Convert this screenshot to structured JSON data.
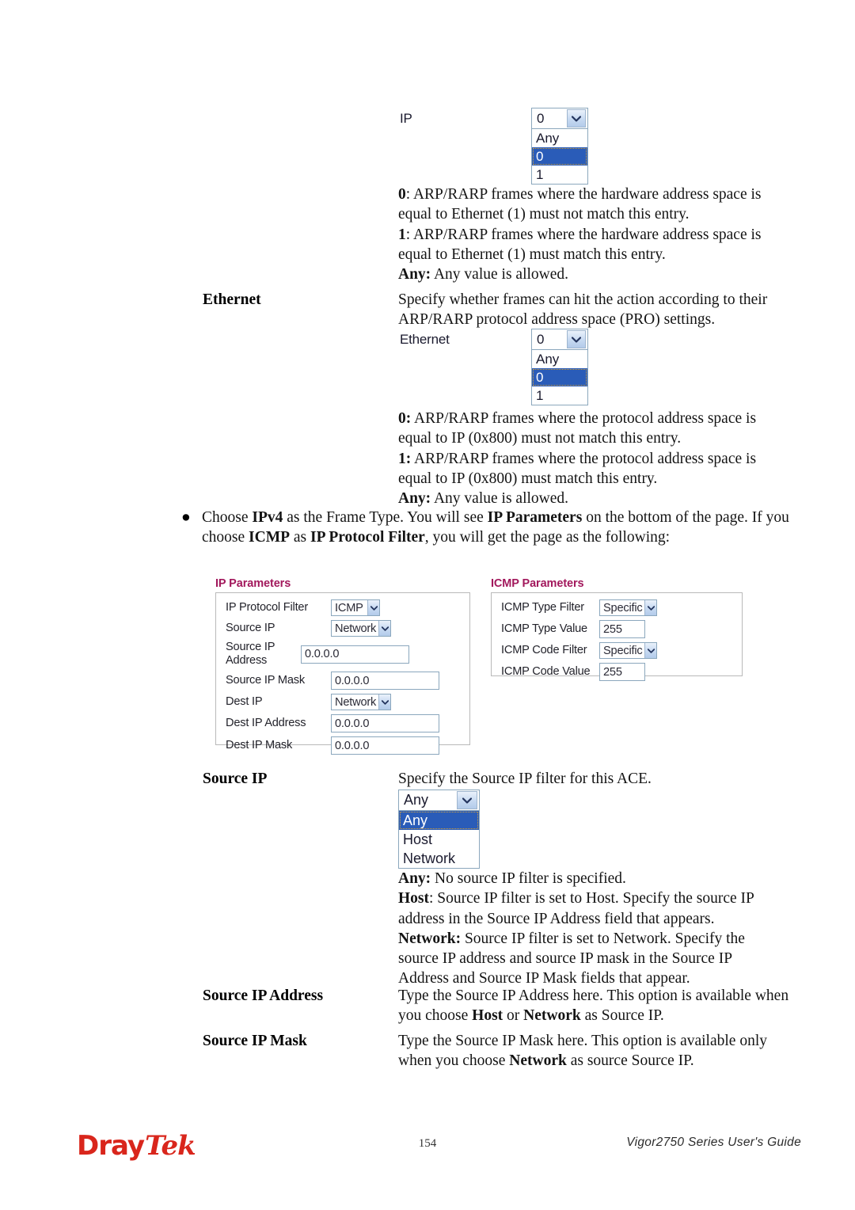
{
  "document": {
    "page_number": "154",
    "guide_title": "Vigor2750 Series User's Guide",
    "logo": {
      "part1": "Dray",
      "part2": "Tek"
    }
  },
  "ip_widget": {
    "label": "IP",
    "selected": "0",
    "options": [
      "Any",
      "0",
      "1"
    ],
    "selected_index": 1
  },
  "ip_descriptions": {
    "line1_term": "0",
    "line1_text": ": ARP/RARP frames where the hardware address space is equal to Ethernet (1) must not match this entry.",
    "line2_term": "1",
    "line2_text": ": ARP/RARP frames where the hardware address space is equal to Ethernet (1) must match this entry.",
    "line3_term": "Any:",
    "line3_text": " Any value is allowed."
  },
  "ethernet_section": {
    "term": "Ethernet",
    "description": "Specify whether frames can hit the action according to their ARP/RARP protocol address space (PRO) settings.",
    "widget": {
      "label": "Ethernet",
      "selected": "0",
      "options": [
        "Any",
        "0",
        "1"
      ],
      "selected_index": 1
    },
    "line1_term": "0:",
    "line1_text": " ARP/RARP frames where the protocol address space is equal to IP (0x800) must not match this entry.",
    "line2_term": "1:",
    "line2_text": " ARP/RARP frames where the protocol address space is equal to IP (0x800) must match this entry.",
    "line3_term": "Any:",
    "line3_text": " Any value is allowed."
  },
  "bullet": {
    "marker": "●",
    "seg1": "Choose ",
    "b1": "IPv4",
    "seg2": " as the Frame Type. You will see ",
    "b2": "IP Parameters",
    "seg3": " on the bottom of the page. If you choose ",
    "b3": "ICMP",
    "seg4": " as ",
    "b4": "IP Protocol Filter",
    "seg5": ", you will get the page as the following:"
  },
  "ip_parameters_panel": {
    "title": "IP Parameters",
    "rows": [
      {
        "label": "IP Protocol Filter",
        "type": "select",
        "value": "ICMP"
      },
      {
        "label": "Source IP",
        "type": "select",
        "value": "Network"
      },
      {
        "label": "Source IP Address",
        "type": "text",
        "value": "0.0.0.0"
      },
      {
        "label": "Source IP Mask",
        "type": "text",
        "value": "0.0.0.0"
      },
      {
        "label": "Dest IP",
        "type": "select",
        "value": "Network"
      },
      {
        "label": "Dest IP Address",
        "type": "text",
        "value": "0.0.0.0"
      },
      {
        "label": "Dest IP Mask",
        "type": "text",
        "value": "0.0.0.0"
      }
    ]
  },
  "icmp_parameters_panel": {
    "title": "ICMP Parameters",
    "rows": [
      {
        "label": "ICMP Type Filter",
        "type": "select",
        "value": "Specific"
      },
      {
        "label": "ICMP Type Value",
        "type": "text",
        "value": "255"
      },
      {
        "label": "ICMP Code Filter",
        "type": "select",
        "value": "Specific"
      },
      {
        "label": "ICMP Code Value",
        "type": "text",
        "value": "255"
      }
    ]
  },
  "source_ip_section": {
    "term": "Source IP",
    "description": "Specify the Source IP filter for this ACE.",
    "widget": {
      "selected": "Any",
      "options": [
        "Any",
        "Host",
        "Network"
      ],
      "selected_index": 0
    },
    "any_term": "Any:",
    "any_text": " No source IP filter is specified.",
    "host_term": "Host",
    "host_text": ": Source IP filter is set to Host. Specify the source IP address in the Source IP Address field that appears.",
    "network_term": "Network:",
    "network_text": " Source IP filter is set to Network. Specify the source IP address and source IP mask in the Source IP Address and Source IP Mask fields that appear."
  },
  "source_ip_address_section": {
    "term": "Source IP Address",
    "seg1": "Type the Source IP Address here. This option is available when you choose ",
    "b1": "Host",
    "seg2": " or ",
    "b2": "Network",
    "seg3": " as Source IP."
  },
  "source_ip_mask_section": {
    "term": "Source IP Mask",
    "seg1": "Type the Source IP Mask here. This option is available only when you choose ",
    "b1": "Network",
    "seg2": " as source Source IP."
  },
  "colors": {
    "panel_title": "#a2185c",
    "logo_red": "#d9261c",
    "select_highlight": "#2a5cb8",
    "control_border": "#8ba7bd"
  }
}
